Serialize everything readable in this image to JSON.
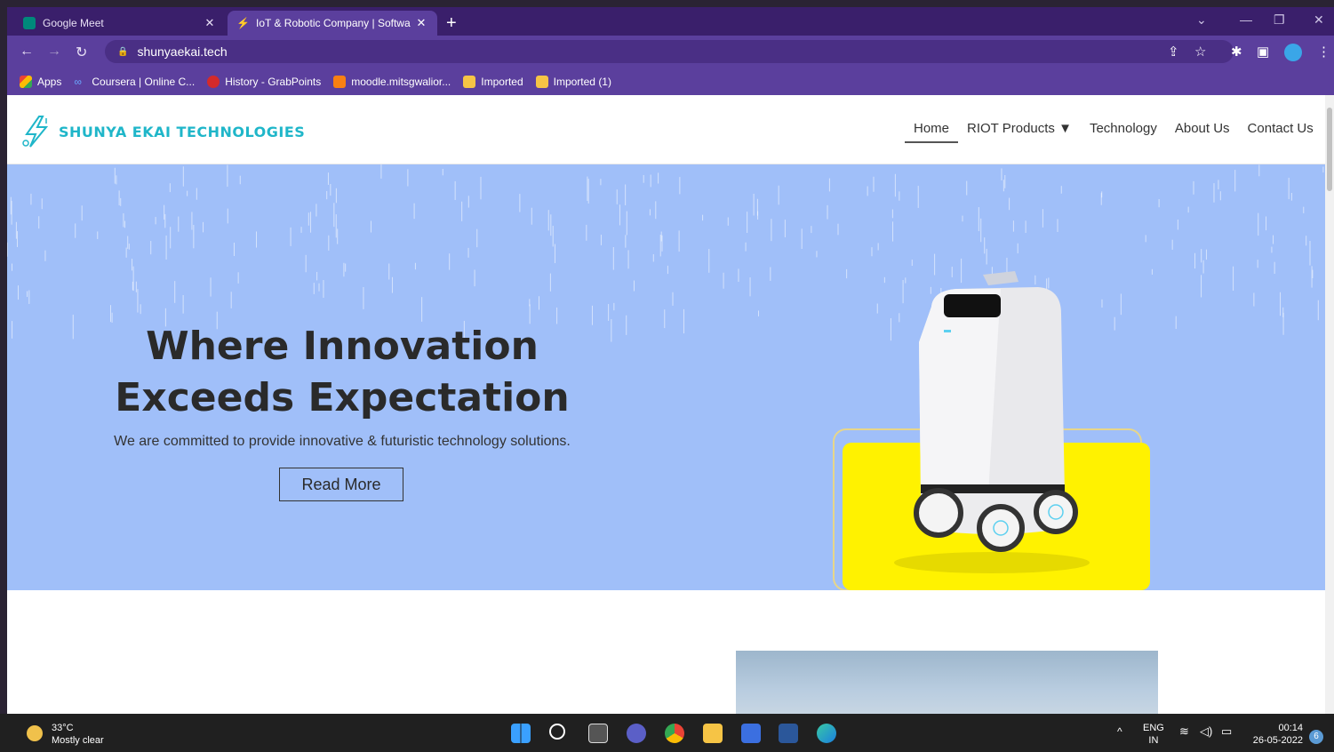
{
  "browser": {
    "tabs": [
      {
        "title": "Google Meet",
        "active": false
      },
      {
        "title": "IoT & Robotic Company | Softwa",
        "active": true
      }
    ],
    "url": "shunyaekai.tech",
    "bookmarks": [
      {
        "label": "Apps",
        "icon": "apps-grid-icon"
      },
      {
        "label": "Coursera | Online C...",
        "icon": "coursera-icon"
      },
      {
        "label": "History - GrabPoints",
        "icon": "grabpoints-icon"
      },
      {
        "label": "moodle.mitsgwalior...",
        "icon": "moodle-icon"
      },
      {
        "label": "Imported",
        "icon": "folder-icon"
      },
      {
        "label": "Imported (1)",
        "icon": "folder-icon"
      }
    ]
  },
  "site": {
    "logo_text": "SHUNYA EKAI TECHNOLOGIES",
    "nav": [
      {
        "label": "Home",
        "active": true
      },
      {
        "label": "RIOT Products ▼",
        "active": false
      },
      {
        "label": "Technology",
        "active": false
      },
      {
        "label": "About Us",
        "active": false
      },
      {
        "label": "Contact Us",
        "active": false
      }
    ],
    "hero": {
      "title_line1": "Where Innovation",
      "title_line2": "Exceeds Expectation",
      "subtitle": "We are committed to provide innovative & futuristic technology solutions.",
      "button": "Read More",
      "background": "#a0bff9",
      "accent_yellow": "#fff200"
    }
  },
  "taskbar": {
    "weather_temp": "33°C",
    "weather_desc": "Mostly clear",
    "lang_top": "ENG",
    "lang_bottom": "IN",
    "time": "00:14",
    "date": "26-05-2022",
    "notifications": "6"
  }
}
